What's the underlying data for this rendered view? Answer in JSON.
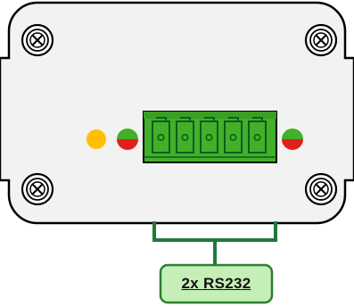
{
  "device": {
    "enclosure_fill": "#f2f2f2",
    "outline_color": "#000000",
    "connector_color": "#43b02a",
    "connector_dark": "#0b5e1c",
    "pin_count": 5,
    "screw_icon": "screw-icon"
  },
  "leds": [
    {
      "name": "status-led-yellow",
      "top_color": "#ffc000",
      "bottom_color": "#ffc000"
    },
    {
      "name": "status-led-left",
      "top_color": "#43b02a",
      "bottom_color": "#e0201b"
    },
    {
      "name": "status-led-right",
      "top_color": "#43b02a",
      "bottom_color": "#e0201b"
    }
  ],
  "callout": {
    "label": "2x RS232",
    "fill": "#c6efb8",
    "border": "#2e7d32",
    "bracket_color": "#1f7a3a"
  }
}
